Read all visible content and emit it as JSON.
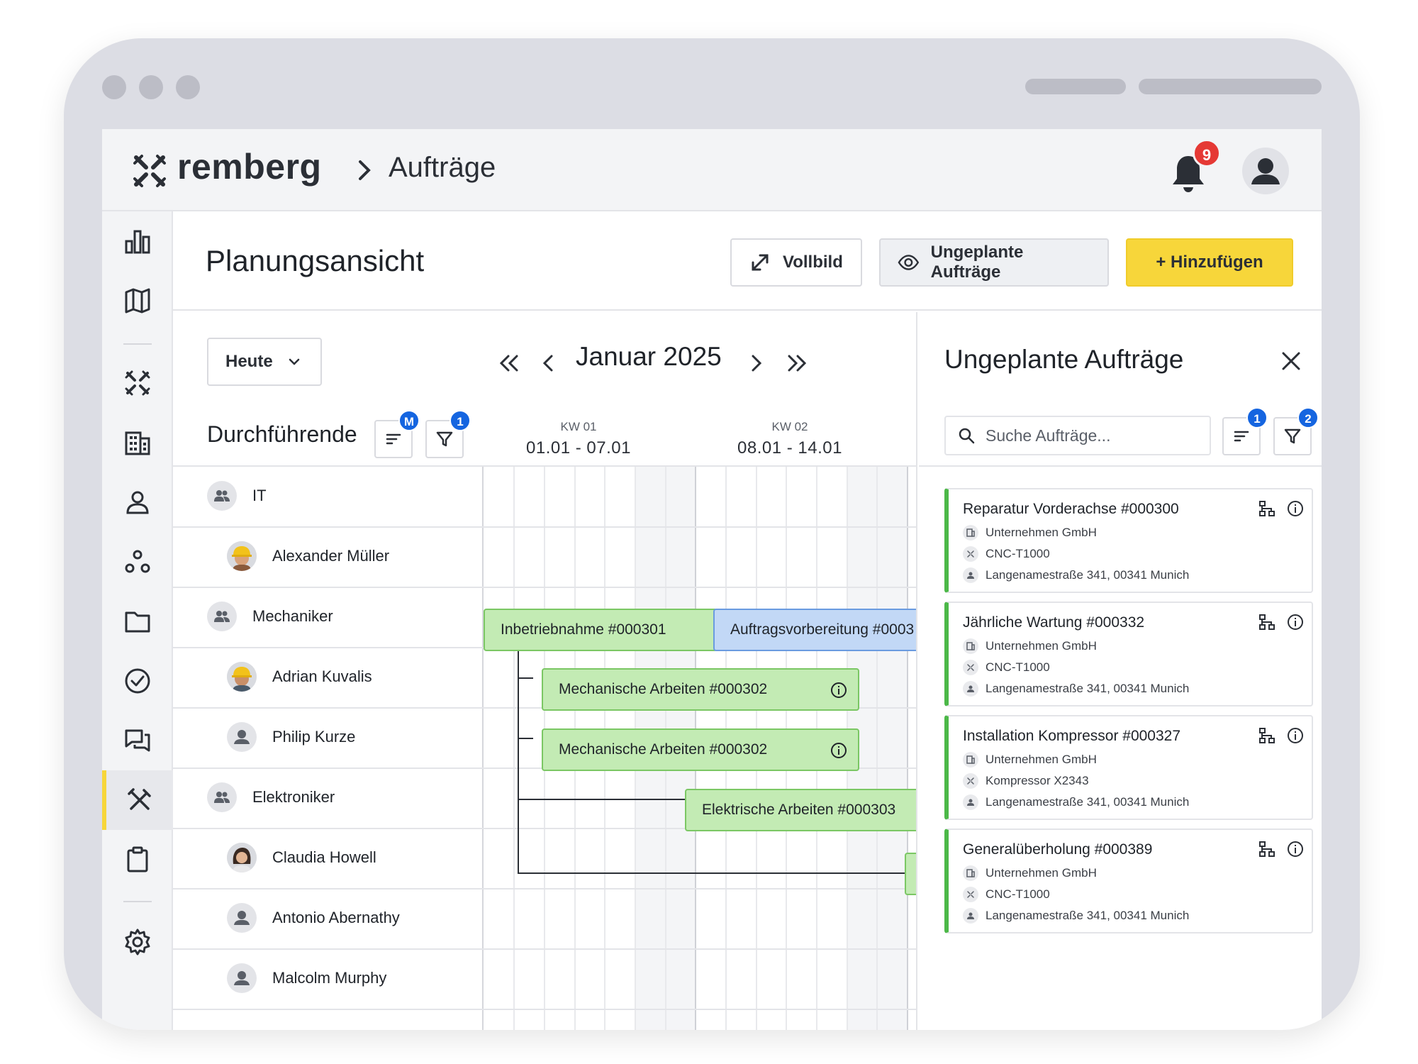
{
  "brand": {
    "name": "remberg"
  },
  "breadcrumb": {
    "current": "Aufträge"
  },
  "notifications": {
    "count": "9"
  },
  "page": {
    "title": "Planungsansicht"
  },
  "actions": {
    "fullscreen": "Vollbild",
    "unplanned": "Ungeplante Aufträge",
    "add": "+ Hinzufügen"
  },
  "planner": {
    "today_label": "Heute",
    "month": "Januar 2025",
    "resources_label": "Durchführende",
    "sort_badge": "M",
    "filter_badge": "1",
    "weeks": [
      {
        "kw": "KW 01",
        "range": "01.01 - 07.01"
      },
      {
        "kw": "KW 02",
        "range": "08.01 - 14.01"
      }
    ],
    "rows": [
      {
        "type": "group",
        "name": "IT"
      },
      {
        "type": "person",
        "name": "Alexander Müller"
      },
      {
        "type": "group",
        "name": "Mechaniker"
      },
      {
        "type": "person",
        "name": "Adrian Kuvalis"
      },
      {
        "type": "person",
        "name": "Philip Kurze"
      },
      {
        "type": "group",
        "name": "Elektroniker"
      },
      {
        "type": "person",
        "name": "Claudia Howell"
      },
      {
        "type": "person",
        "name": "Antonio Abernathy"
      },
      {
        "type": "person",
        "name": "Malcolm Murphy"
      }
    ],
    "tasks": [
      {
        "label": "Inbetriebnahme #000301",
        "status": "green"
      },
      {
        "label": "Auftragsvorbereitung #0003",
        "status": "blue"
      },
      {
        "label": "Mechanische Arbeiten #000302",
        "status": "green"
      },
      {
        "label": "Mechanische Arbeiten #000302",
        "status": "green"
      },
      {
        "label": "Elektrische Arbeiten #000303",
        "status": "green"
      }
    ]
  },
  "unplanned": {
    "title": "Ungeplante Aufträge",
    "search_placeholder": "Suche Aufträge...",
    "sort_badge": "1",
    "filter_badge": "2",
    "orders": [
      {
        "title": "Reparatur Vorderachse #000300",
        "company": "Unternehmen GmbH",
        "asset": "CNC-T1000",
        "address": "Langenamestraße 341, 00341 Munich"
      },
      {
        "title": "Jährliche Wartung #000332",
        "company": "Unternehmen GmbH",
        "asset": "CNC-T1000",
        "address": "Langenamestraße 341, 00341 Munich"
      },
      {
        "title": "Installation Kompressor #000327",
        "company": "Unternehmen GmbH",
        "asset": "Kompressor X2343",
        "address": "Langenamestraße 341, 00341 Munich"
      },
      {
        "title": "Generalüberholung #000389",
        "company": "Unternehmen GmbH",
        "asset": "CNC-T1000",
        "address": "Langenamestraße 341, 00341 Munich"
      }
    ]
  },
  "colors": {
    "accent": "#f7d63a",
    "task_green": "#c3ebb4",
    "task_blue": "#c2d8f6",
    "status_green": "#4cb848",
    "badge_red": "#e53935",
    "badge_blue": "#1565e0"
  }
}
